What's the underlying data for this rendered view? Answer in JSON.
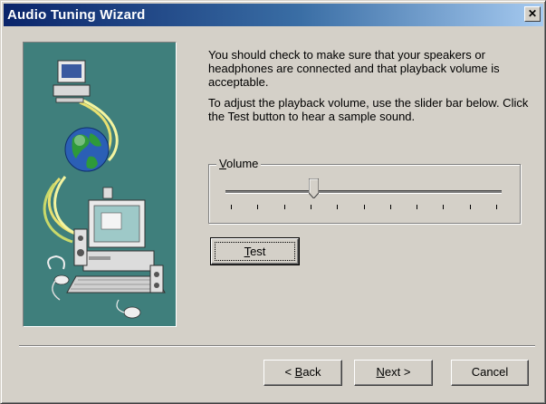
{
  "window": {
    "title": "Audio Tuning Wizard",
    "close_glyph": "✕"
  },
  "instructions": {
    "paragraph1": "You should check to make sure that your speakers or headphones are connected and that playback volume is acceptable.",
    "paragraph2": "To adjust the playback volume, use the slider bar below.  Click the Test button to hear a sample sound."
  },
  "volume": {
    "label_first": "V",
    "label_rest": "olume",
    "level": 0.32,
    "ticks": 11
  },
  "buttons": {
    "test_first": "T",
    "test_rest": "est",
    "back_pre": "< ",
    "back_first": "B",
    "back_rest": "ack",
    "next_first": "N",
    "next_rest": "ext >",
    "cancel": "Cancel"
  },
  "icons": [
    "computer-icon",
    "globe-icon",
    "speaker-icon",
    "microphone-icon"
  ],
  "colors": {
    "title_start": "#0a246a",
    "title_end": "#a6caf0",
    "panel_bg": "#3f7f7c",
    "face": "#d4d0c8"
  }
}
